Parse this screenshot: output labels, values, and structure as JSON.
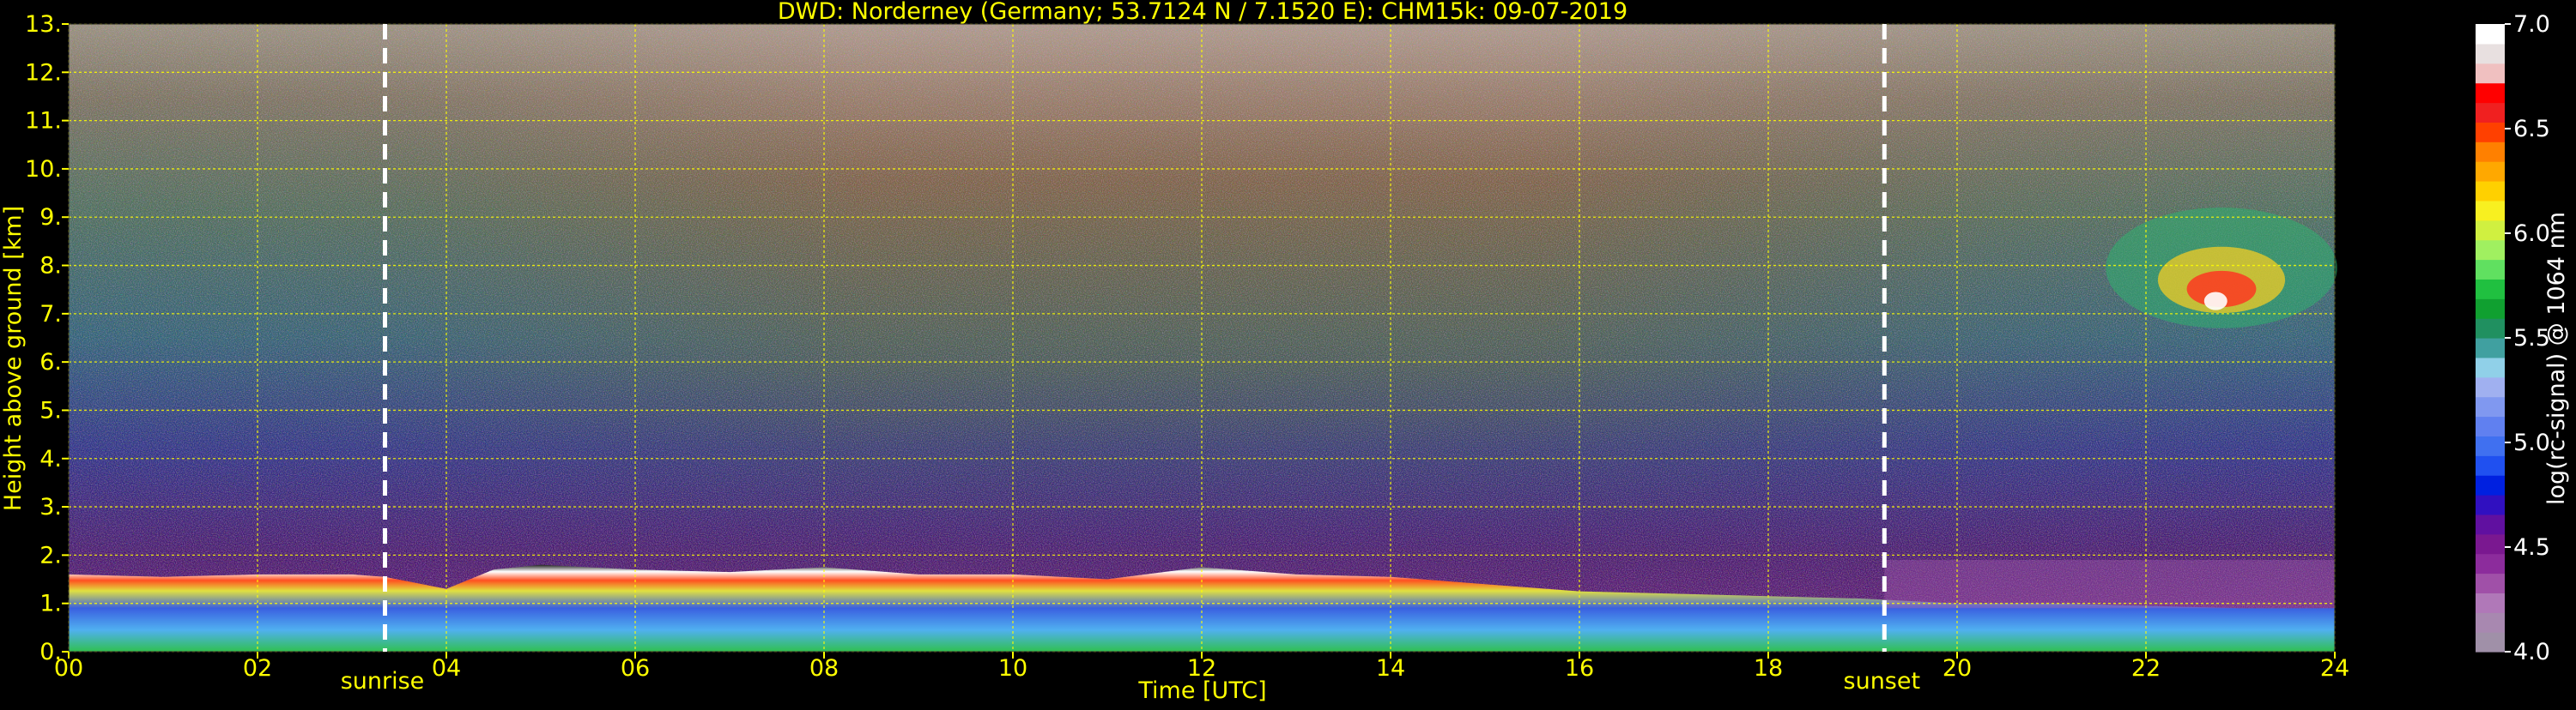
{
  "chart_data": {
    "type": "heatmap",
    "title": "DWD: Norderney (Germany; 53.7124 N / 7.1520 E):    CHM15k: 09-07-2019",
    "xlabel": "Time [UTC]",
    "ylabel": "Height above ground [km]",
    "xlim": [
      0,
      24
    ],
    "ylim": [
      0,
      13
    ],
    "x_ticks": [
      "00",
      "02",
      "04",
      "06",
      "08",
      "10",
      "12",
      "14",
      "16",
      "18",
      "20",
      "22",
      "24"
    ],
    "x_tick_values": [
      0,
      2,
      4,
      6,
      8,
      10,
      12,
      14,
      16,
      18,
      20,
      22,
      24
    ],
    "y_ticks": [
      "0.",
      "1.",
      "2.",
      "3.",
      "4.",
      "5.",
      "6.",
      "7.",
      "8.",
      "9.",
      "10.",
      "11.",
      "12.",
      "13."
    ],
    "y_tick_values": [
      0,
      1,
      2,
      3,
      4,
      5,
      6,
      7,
      8,
      9,
      10,
      11,
      12,
      13
    ],
    "grid": true,
    "annotations": [
      {
        "label": "sunrise",
        "x": 3.35
      },
      {
        "label": "sunset",
        "x": 19.23
      }
    ],
    "colorbar": {
      "label": "log(rc-signal) @ 1064 nm",
      "range": [
        4.0,
        7.0
      ],
      "ticks": [
        "4.0",
        "4.5",
        "5.0",
        "5.5",
        "6.0",
        "6.5",
        "7.0"
      ],
      "tick_values": [
        4.0,
        4.5,
        5.0,
        5.5,
        6.0,
        6.5,
        7.0
      ],
      "colors": [
        "#a090a8",
        "#a888b0",
        "#b078b8",
        "#a050a8",
        "#8c2c9c",
        "#7a1890",
        "#6010a0",
        "#3010c0",
        "#0020e0",
        "#2050f0",
        "#4070f0",
        "#6080f0",
        "#8098f0",
        "#a0b0f0",
        "#90d0e8",
        "#40a0a0",
        "#209060",
        "#10a030",
        "#20c040",
        "#60e060",
        "#a0f060",
        "#d0f040",
        "#f8f020",
        "#ffd000",
        "#ffa800",
        "#ff8000",
        "#ff4000",
        "#f02020",
        "#ff0000",
        "#f0c0c0",
        "#e8e0e0",
        "#ffffff"
      ]
    },
    "boundary_layer_top_km": [
      [
        0,
        1.6
      ],
      [
        1,
        1.55
      ],
      [
        2,
        1.6
      ],
      [
        3,
        1.6
      ],
      [
        3.35,
        1.55
      ],
      [
        4,
        1.3
      ],
      [
        4.5,
        1.7
      ],
      [
        5,
        1.8
      ],
      [
        6,
        1.7
      ],
      [
        7,
        1.65
      ],
      [
        8,
        1.75
      ],
      [
        9,
        1.6
      ],
      [
        10,
        1.6
      ],
      [
        11,
        1.5
      ],
      [
        12,
        1.75
      ],
      [
        13,
        1.6
      ],
      [
        14,
        1.55
      ],
      [
        15,
        1.4
      ],
      [
        16,
        1.25
      ],
      [
        17,
        1.2
      ],
      [
        18,
        1.15
      ],
      [
        19,
        1.1
      ],
      [
        20,
        1.0
      ],
      [
        21,
        1.0
      ],
      [
        22,
        0.95
      ],
      [
        23,
        0.9
      ],
      [
        24,
        0.9
      ]
    ],
    "high_cloud_layer": {
      "x_start": 20.5,
      "x_end": 24,
      "base_km": 7.0,
      "top_km": 9.5,
      "peak_at": 22.8
    }
  }
}
